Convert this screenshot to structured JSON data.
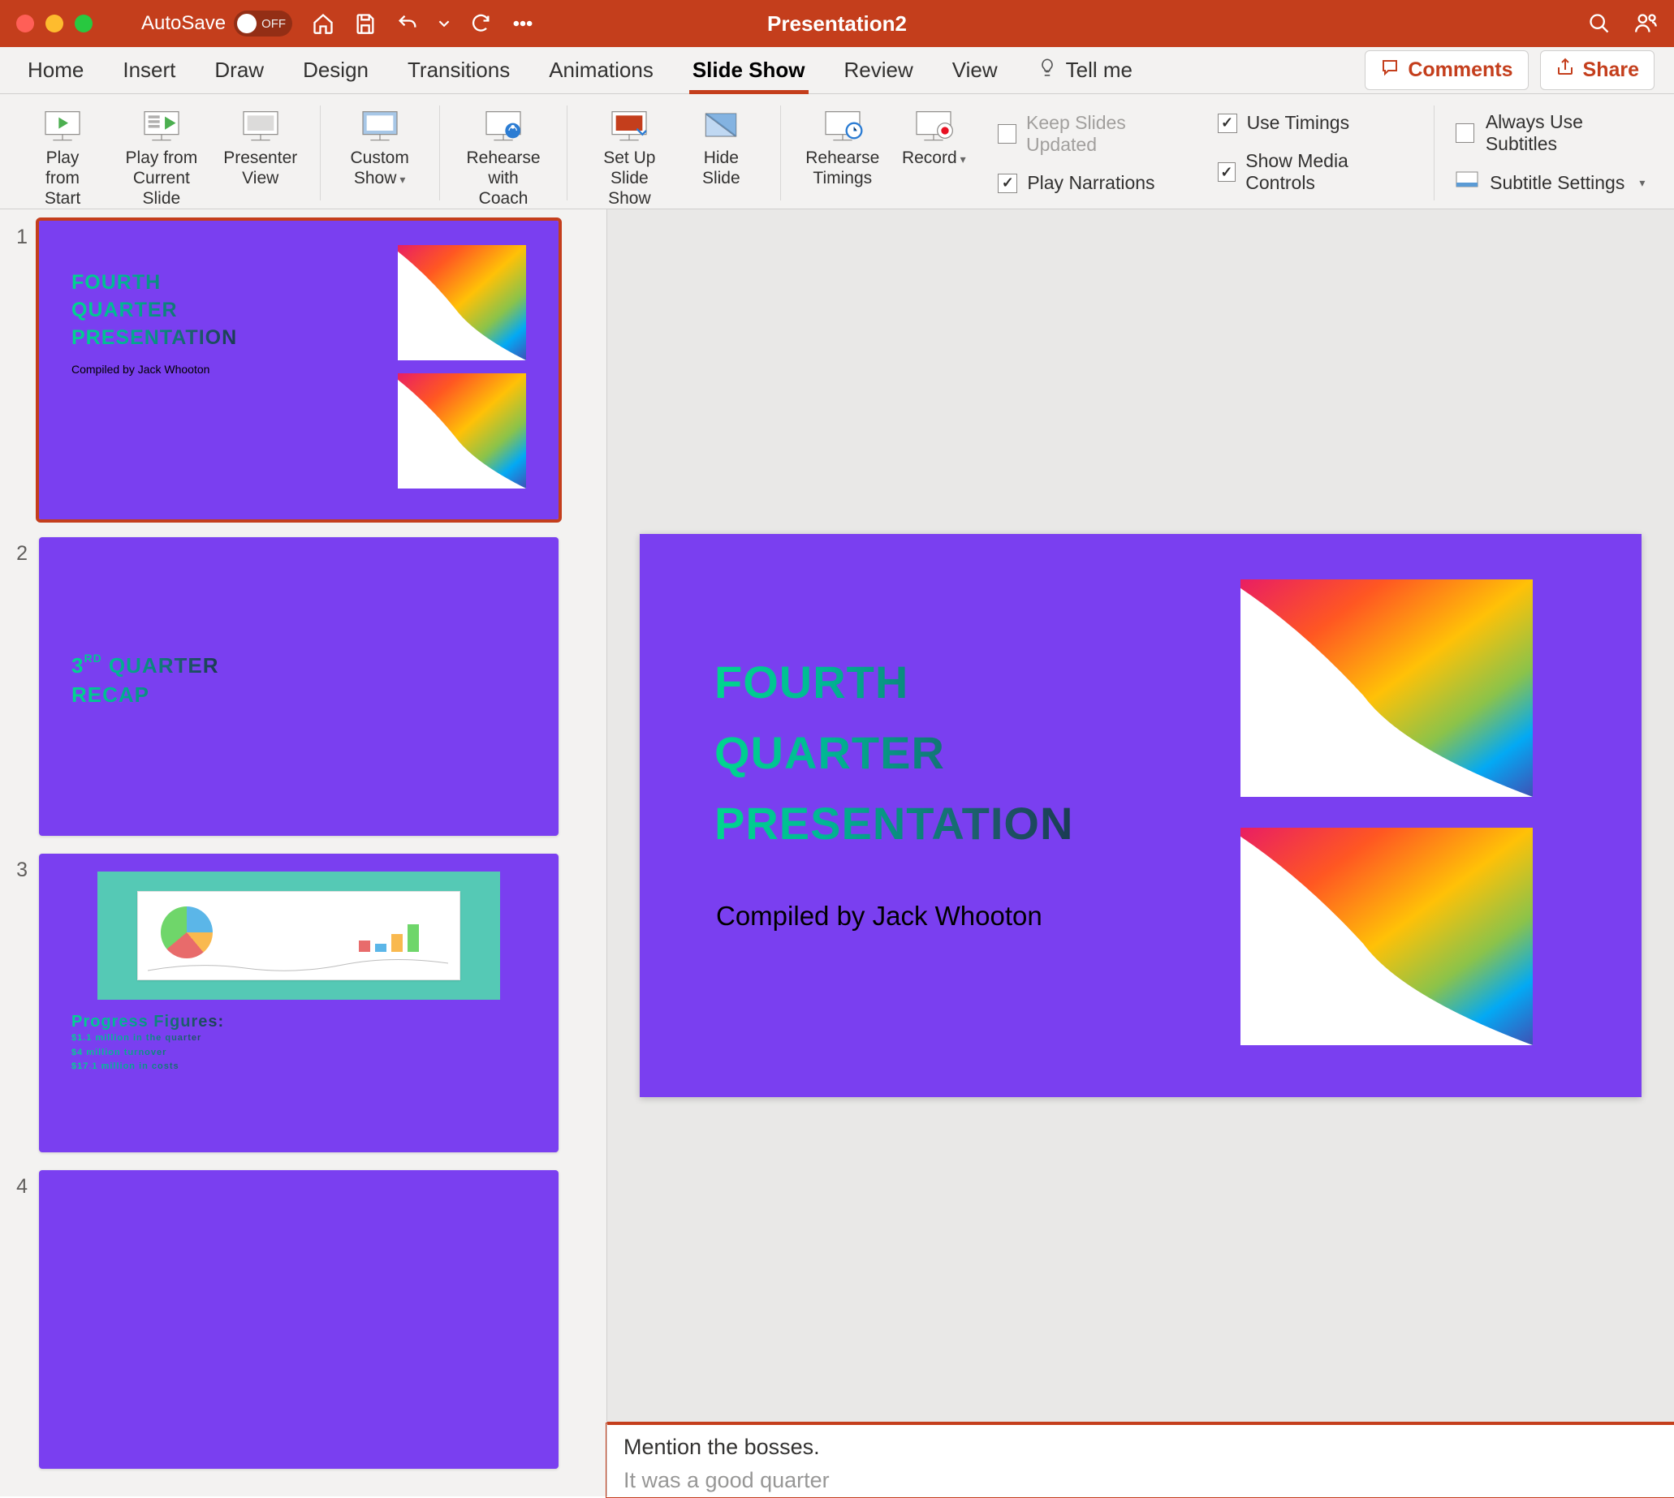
{
  "titlebar": {
    "autosave_label": "AutoSave",
    "autosave_state": "OFF",
    "document_title": "Presentation2"
  },
  "tabs": {
    "items": [
      "Home",
      "Insert",
      "Draw",
      "Design",
      "Transitions",
      "Animations",
      "Slide Show",
      "Review",
      "View"
    ],
    "active_index": 6,
    "tellme": "Tell me",
    "comments": "Comments",
    "share": "Share"
  },
  "ribbon": {
    "play_from_start": "Play from\nStart",
    "play_from_current": "Play from\nCurrent Slide",
    "presenter_view": "Presenter\nView",
    "custom_show": "Custom\nShow",
    "rehearse_coach": "Rehearse\nwith Coach",
    "setup_slide_show": "Set Up\nSlide Show",
    "hide_slide": "Hide\nSlide",
    "rehearse_timings": "Rehearse\nTimings",
    "record": "Record",
    "keep_slides_updated": "Keep Slides Updated",
    "play_narrations": "Play Narrations",
    "use_timings": "Use Timings",
    "show_media_controls": "Show Media Controls",
    "always_use_subtitles": "Always Use Subtitles",
    "subtitle_settings": "Subtitle Settings"
  },
  "slides": {
    "thumb1": {
      "line1": "FOURTH",
      "line2": "QUARTER",
      "line3": "PRESENTATION",
      "subtitle": "Compiled by Jack Whooton"
    },
    "thumb2": {
      "line1_pre": "3",
      "line1_sup": "RD",
      "line1_post": " QUARTER",
      "line2": "RECAP"
    },
    "thumb3": {
      "heading": "Progress Figures:",
      "item1": "$1.1 million in the quarter",
      "item2": "$4 million turnover",
      "item3": "$17.1 million in costs"
    },
    "numbers": [
      "1",
      "2",
      "3",
      "4"
    ]
  },
  "main_slide": {
    "line1": "FOURTH",
    "line2": "QUARTER",
    "line3": "PRESENTATION",
    "subtitle": "Compiled by Jack Whooton"
  },
  "notes": {
    "line1": "Mention the bosses.",
    "line2": "It was a good quarter"
  }
}
